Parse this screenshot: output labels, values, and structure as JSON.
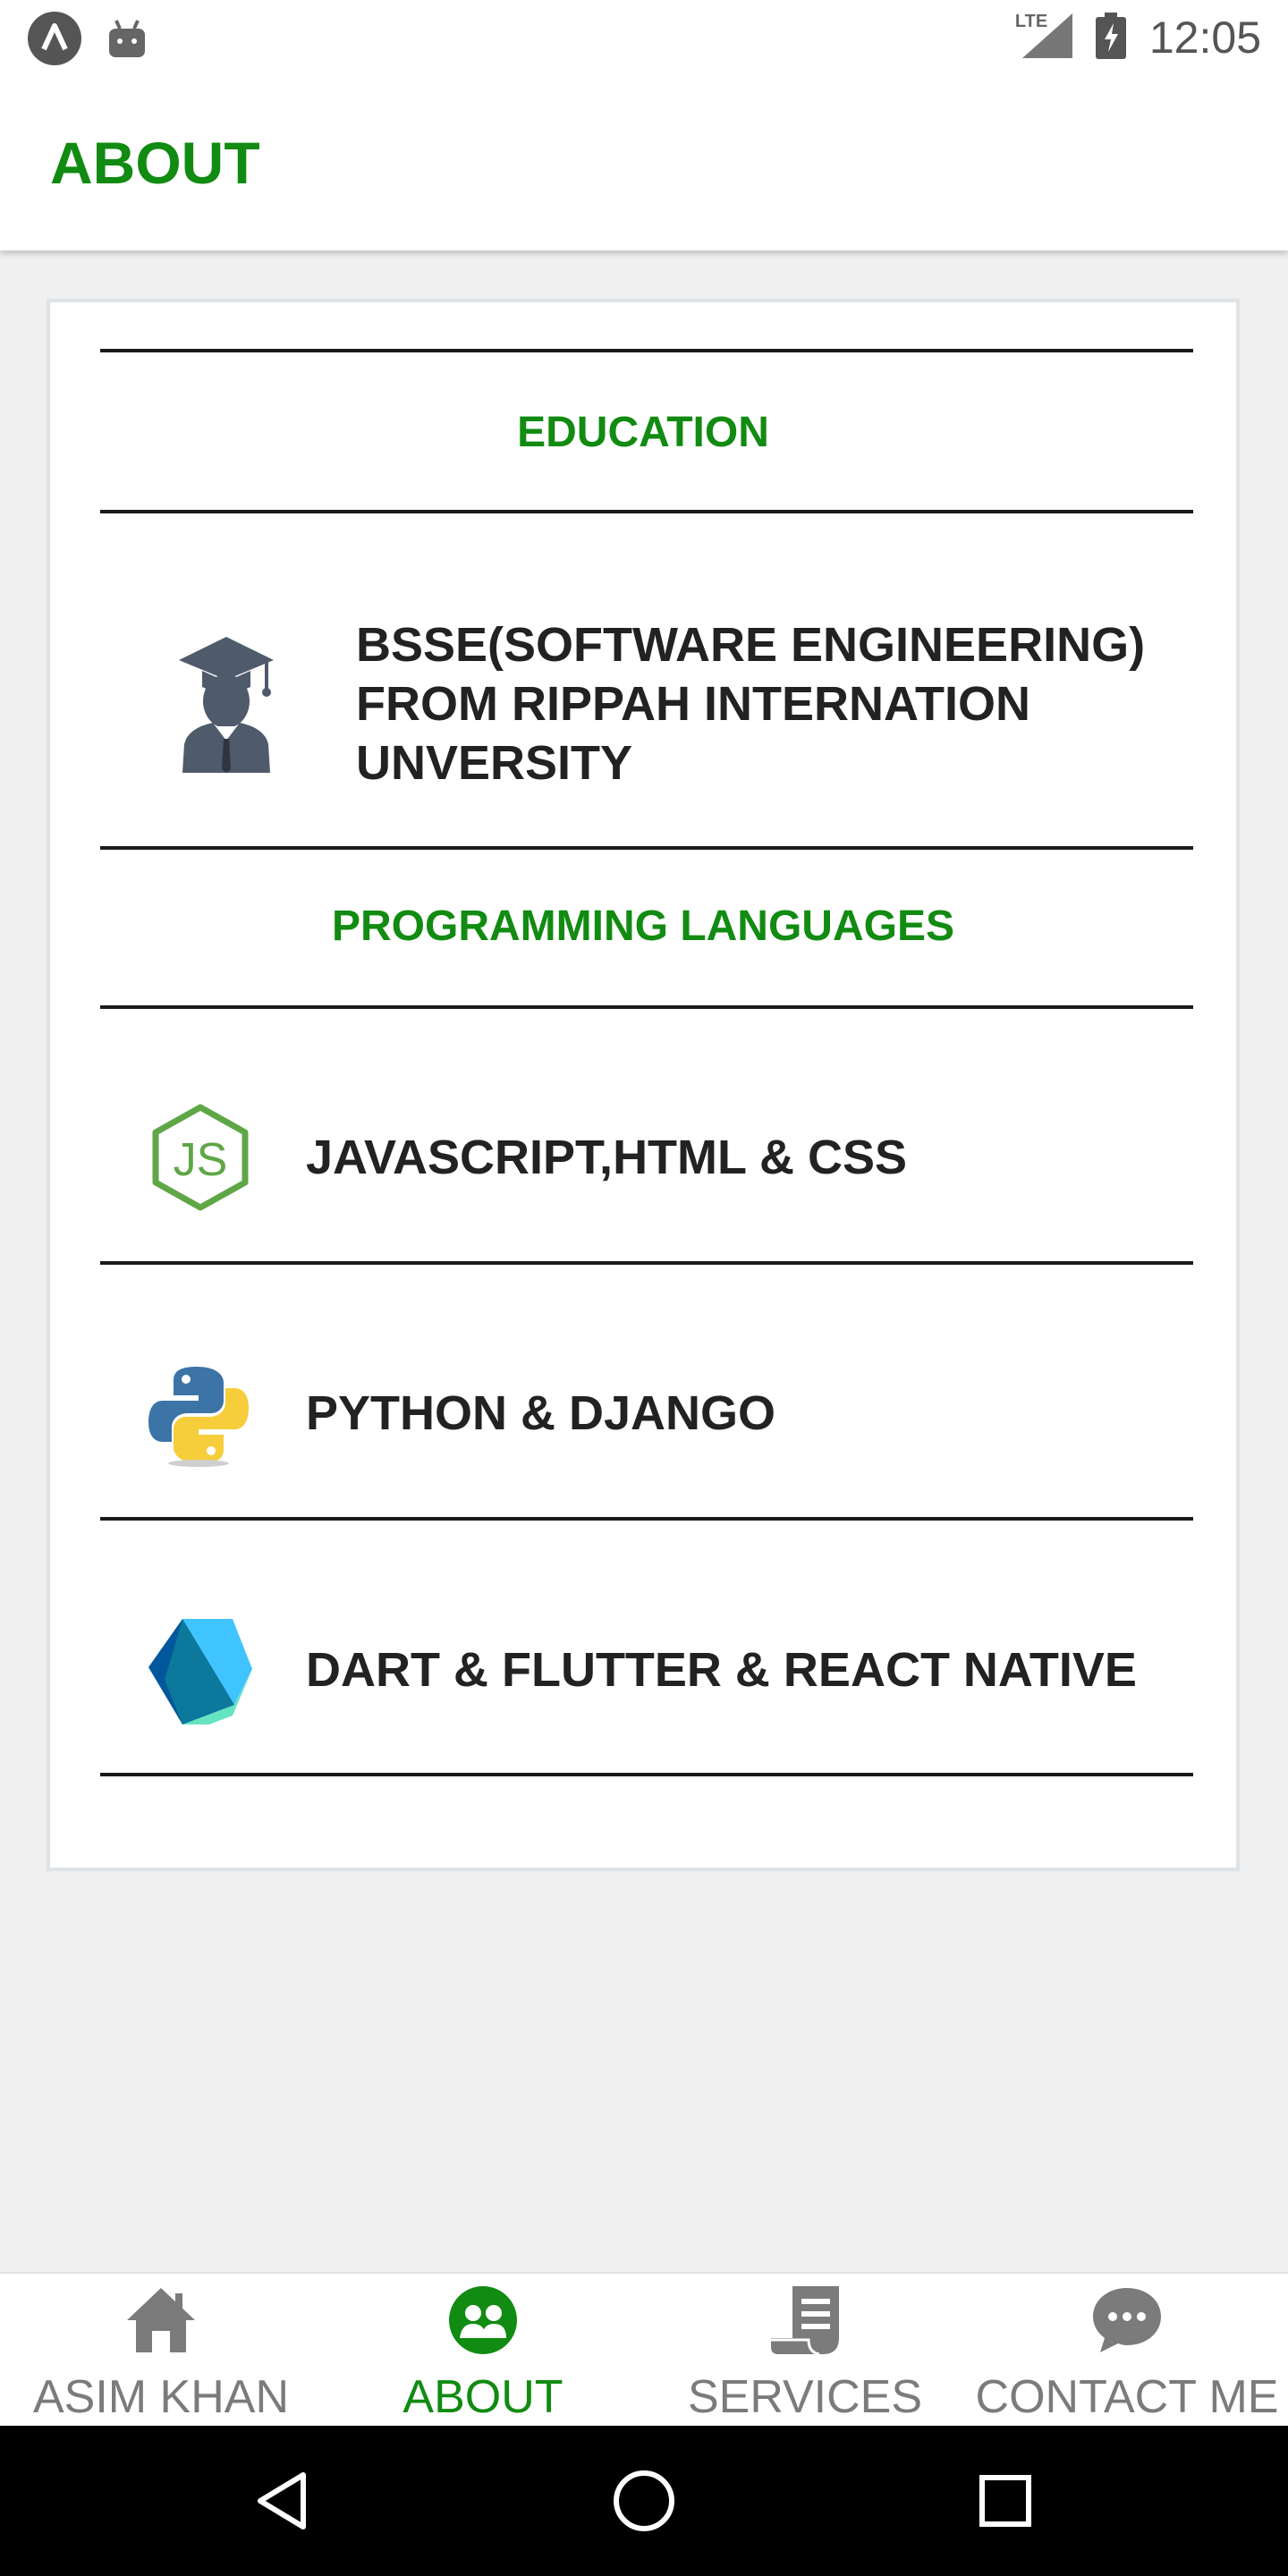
{
  "status_bar": {
    "time": "12:05",
    "network_label": "LTE",
    "icons": [
      "app-logo-icon",
      "android-icon",
      "signal-icon",
      "battery-charging-icon"
    ]
  },
  "app_bar": {
    "title": "ABOUT"
  },
  "colors": {
    "accent": "#118b11",
    "text": "#222222",
    "inactive": "#7b7b7b"
  },
  "education": {
    "heading": "EDUCATION",
    "degree_line1": "BSSE(SOFTWARE ENGINEERING)",
    "degree_line2": "FROM RIPPAH INTERNATION",
    "degree_line3": "UNVERSITY",
    "icon": "graduate-icon"
  },
  "languages": {
    "heading": "PROGRAMMING LANGUAGES",
    "items": [
      {
        "label": "JAVASCRIPT,HTML & CSS",
        "icon": "nodejs-icon"
      },
      {
        "label": "PYTHON & DJANGO",
        "icon": "python-icon"
      },
      {
        "label": "DART & FLUTTER & REACT NATIVE",
        "icon": "dart-icon"
      }
    ]
  },
  "bottom_nav": {
    "active_index": 1,
    "items": [
      {
        "label": "ASIM KHAN",
        "icon": "home-icon"
      },
      {
        "label": "ABOUT",
        "icon": "people-icon"
      },
      {
        "label": "SERVICES",
        "icon": "receipt-icon"
      },
      {
        "label": "CONTACT ME",
        "icon": "chat-icon"
      }
    ]
  },
  "system_nav": {
    "buttons": [
      "back-icon",
      "home-circle-icon",
      "recents-icon"
    ]
  }
}
